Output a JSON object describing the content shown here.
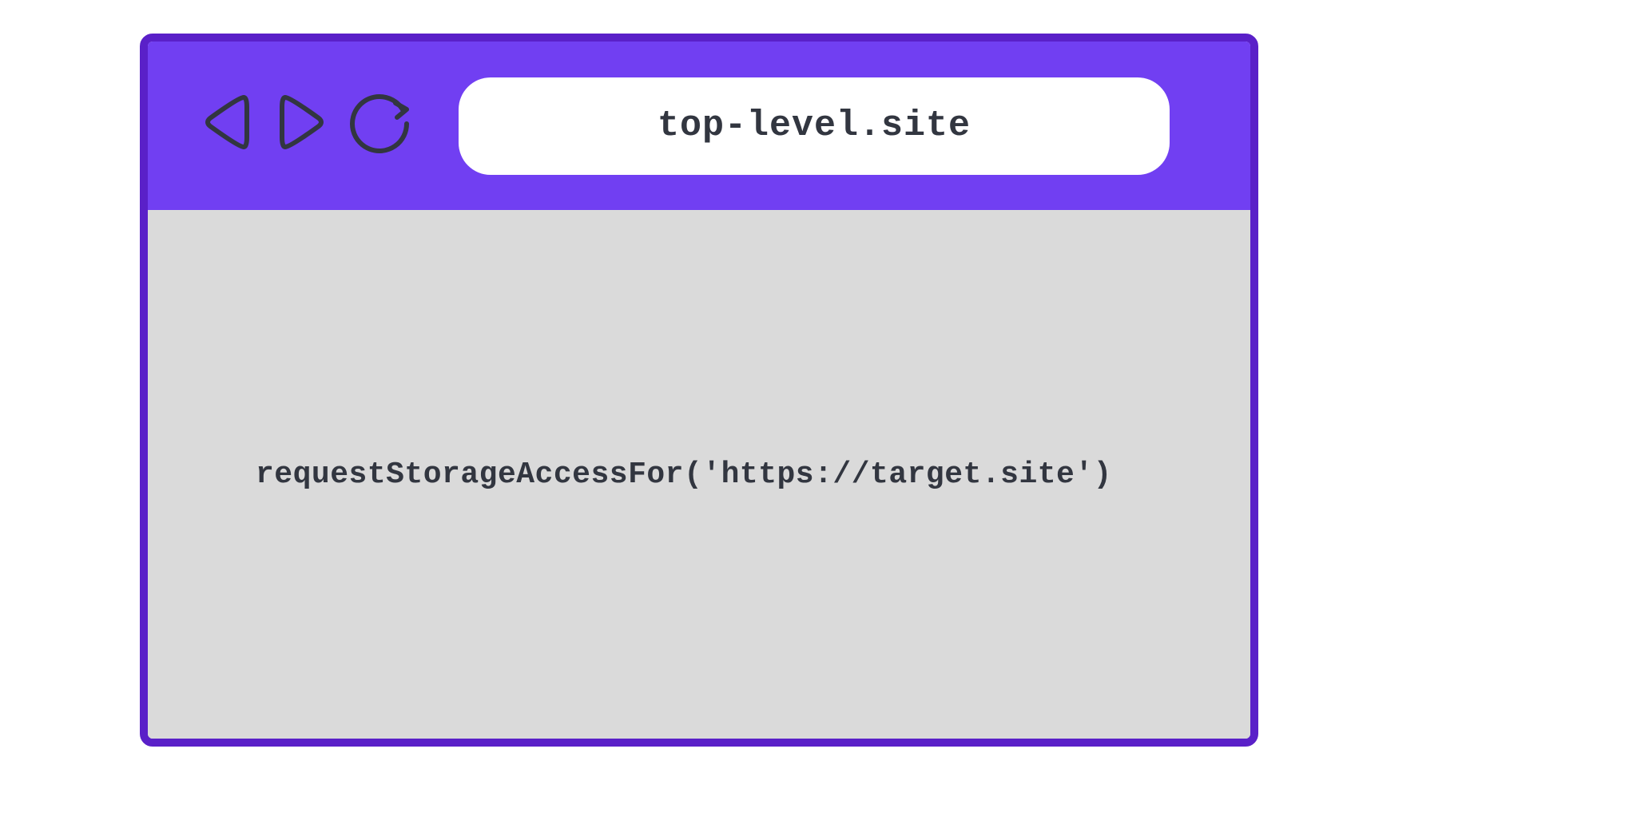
{
  "browser": {
    "address": "top-level.site"
  },
  "page": {
    "code": "requestStorageAccessFor('https://target.site')"
  },
  "colors": {
    "toolbar_bg": "#713ff2",
    "window_border": "#5a20c8",
    "viewport_bg": "#dadada",
    "text": "#323640"
  }
}
